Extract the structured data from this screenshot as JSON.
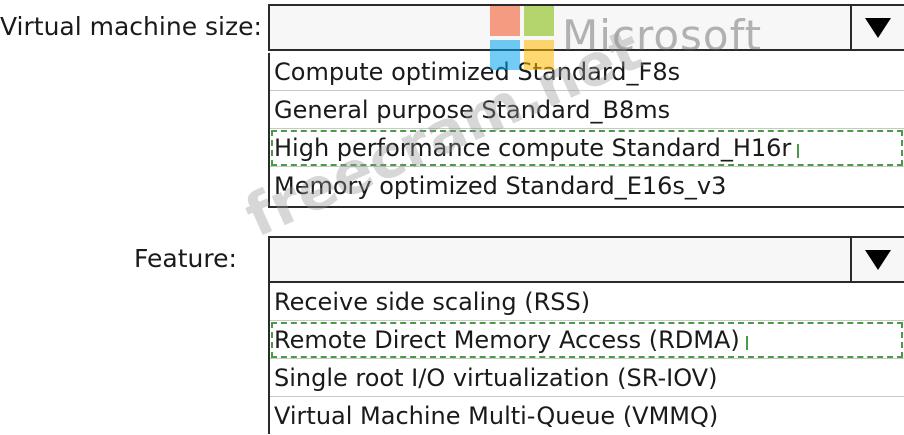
{
  "vm_size": {
    "label": "Virtual machine size:",
    "selected": "",
    "options": [
      "Compute optimized Standard_F8s",
      "General purpose Standard_B8ms",
      "High performance compute Standard_H16r",
      "Memory optimized Standard_E16s_v3"
    ],
    "focused_option_index": 2
  },
  "feature": {
    "label": "Feature:",
    "selected": "",
    "options": [
      "Receive side scaling (RSS)",
      "Remote Direct Memory Access (RDMA)",
      "Single root I/O virtualization (SR-IOV)",
      "Virtual Machine Multi-Queue (VMMQ)"
    ],
    "focused_option_index": 1
  },
  "icons": {
    "dropdown_arrow": "triangle-down-icon"
  },
  "watermark": {
    "brand": "Microsoft",
    "site": "freecram.net",
    "logo_colors": [
      "#f25022",
      "#7fba00",
      "#00a4ef",
      "#ffb900"
    ]
  }
}
